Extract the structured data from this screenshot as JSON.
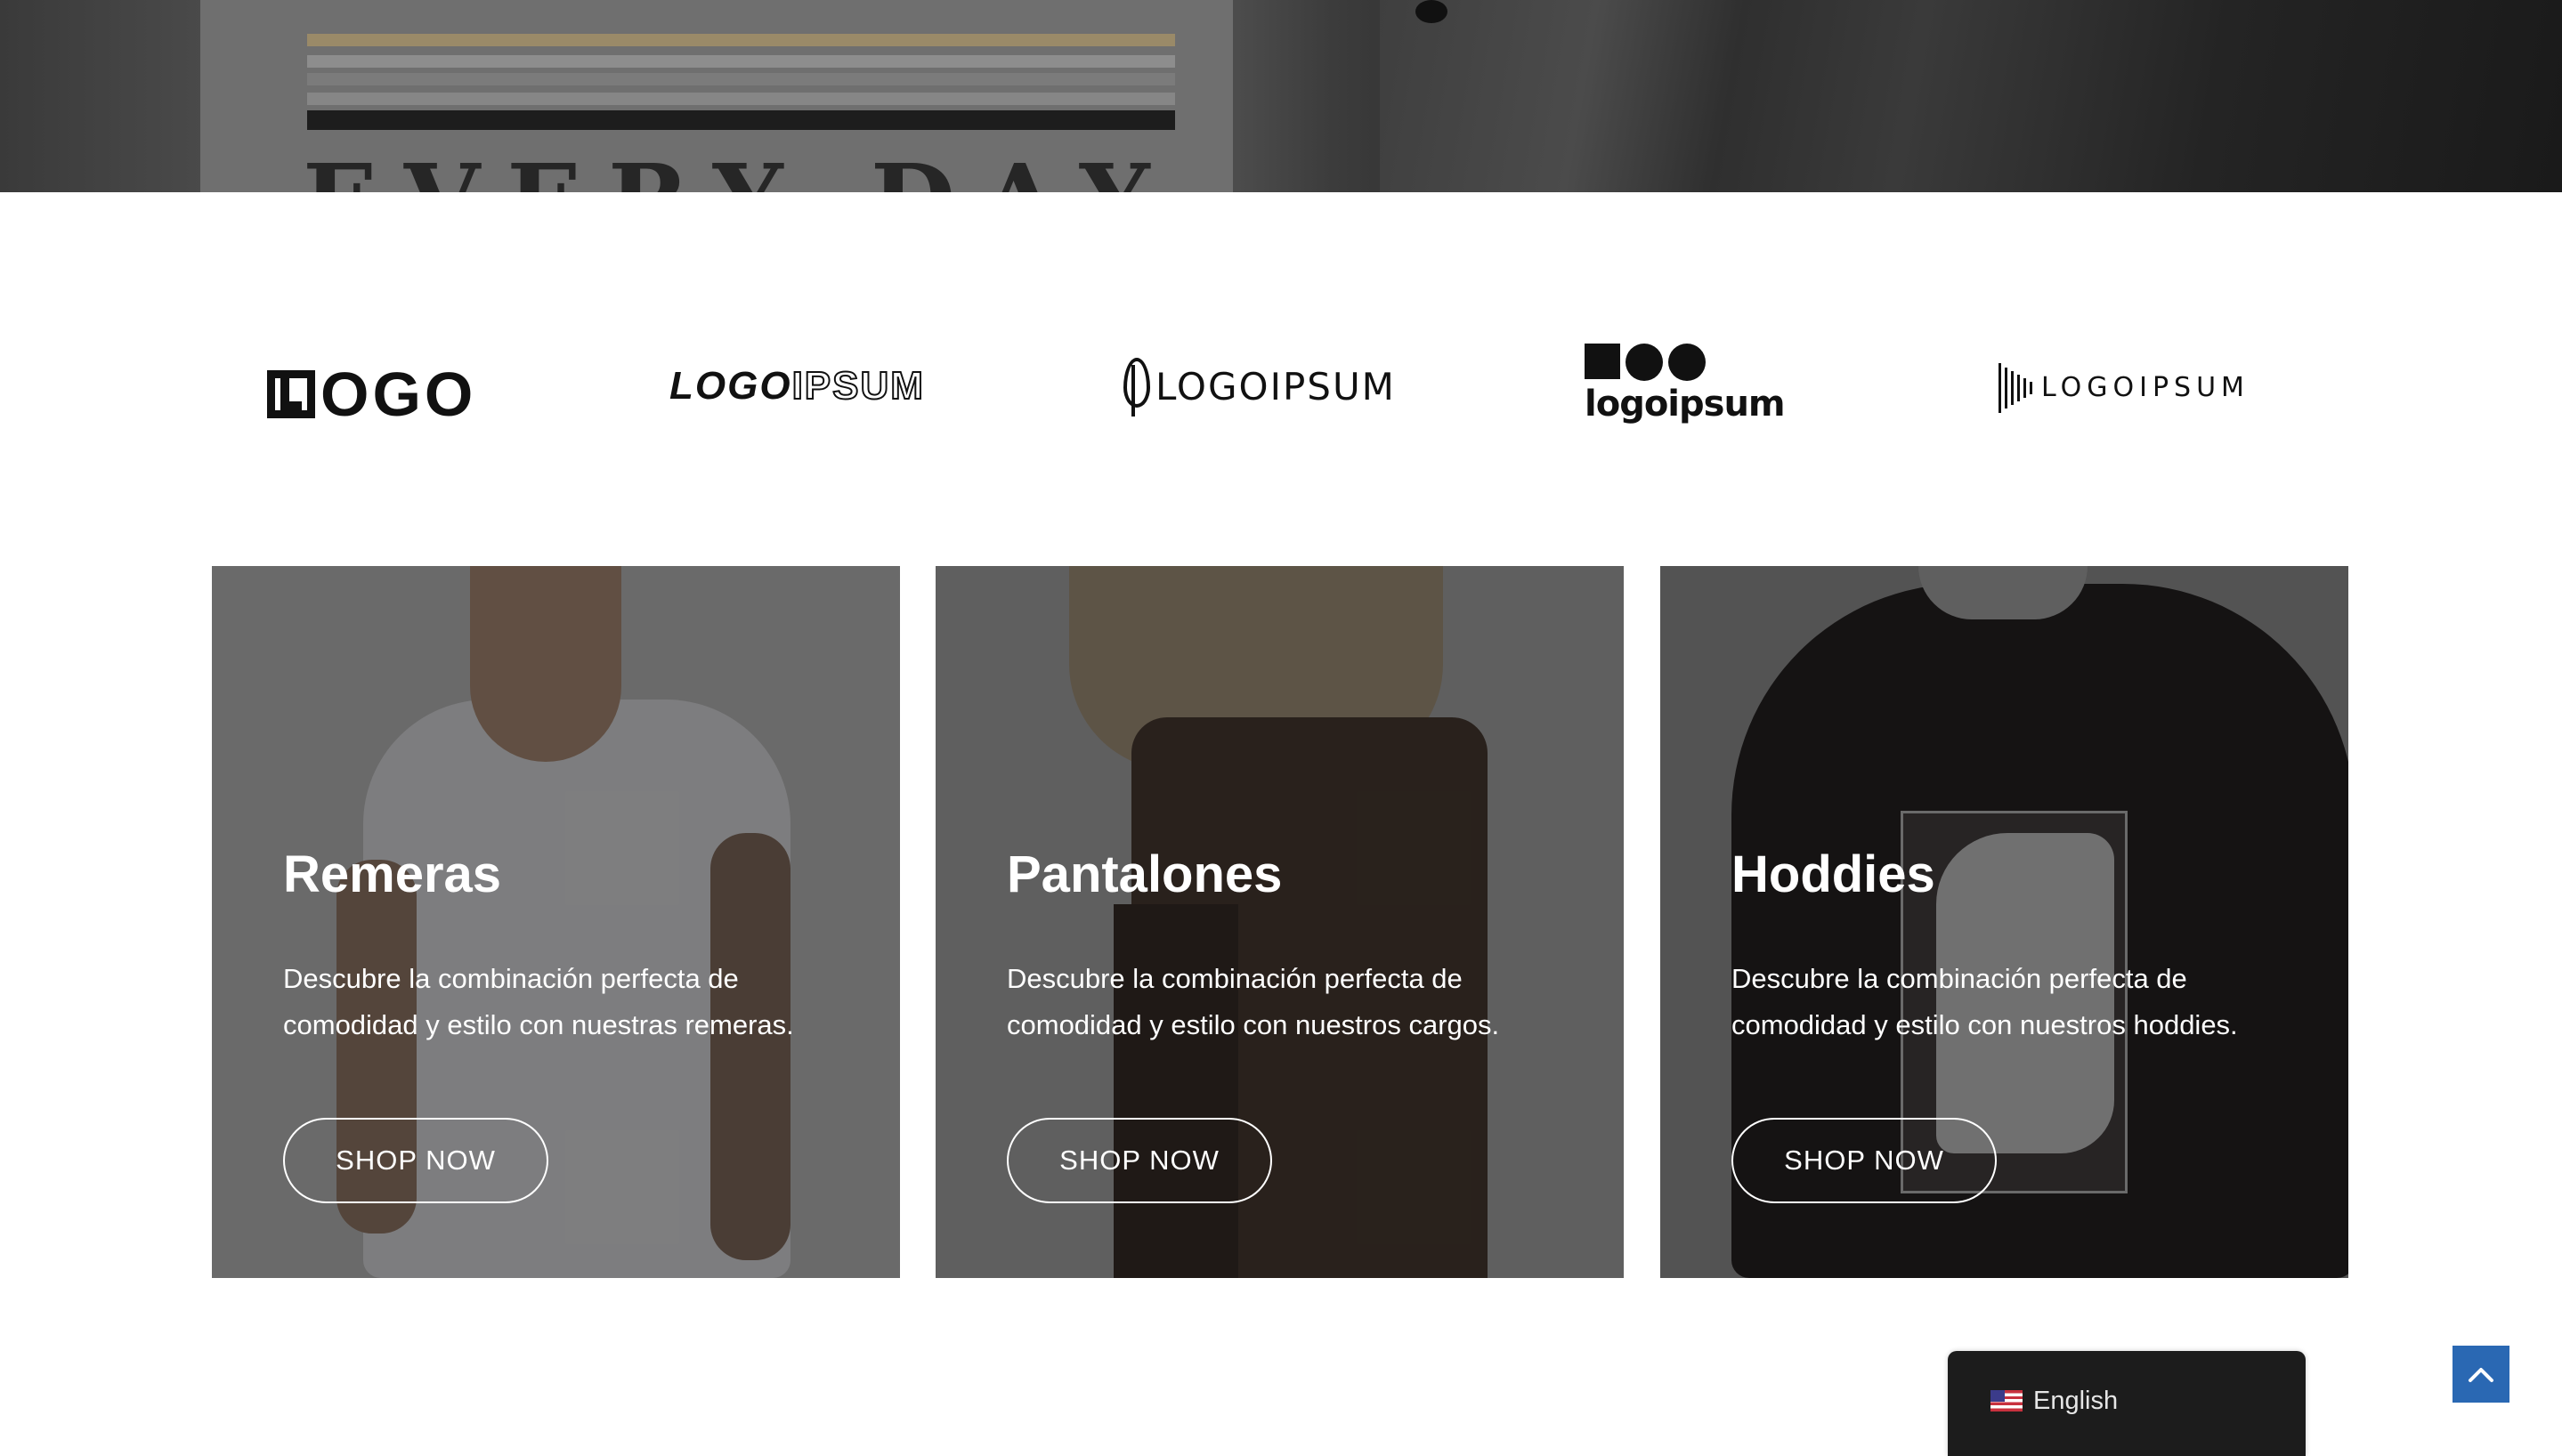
{
  "hero": {
    "image_text": "EVERY DAY"
  },
  "brand_logos": [
    {
      "name": "logo-1",
      "text": "OGO"
    },
    {
      "name": "logo-2",
      "text_bold": "LOGO",
      "text_outline": "IPSUM"
    },
    {
      "name": "logo-3",
      "text": "LOGOIPSUM"
    },
    {
      "name": "logo-4",
      "text": "logoipsum"
    },
    {
      "name": "logo-5",
      "text": "LOGOIPSUM"
    }
  ],
  "cards": [
    {
      "title": "Remeras",
      "description": "Descubre la combinación perfecta de comodidad y estilo con nuestras remeras.",
      "button": "SHOP NOW"
    },
    {
      "title": "Pantalones",
      "description": "Descubre la combinación perfecta de comodidad y estilo con nuestros cargos.",
      "button": "SHOP NOW"
    },
    {
      "title": "Hoddies",
      "description": "Descubre la combinación perfecta de comodidad y estilo con nuestros hoddies.",
      "button": "SHOP NOW"
    }
  ],
  "language_switcher": {
    "flag_icon": "us-flag-icon",
    "label": "English"
  },
  "scroll_top": {
    "icon": "chevron-up-icon"
  },
  "colors": {
    "scroll_top_bg": "#2a68b3",
    "lang_bg": "#1c1c1c"
  }
}
